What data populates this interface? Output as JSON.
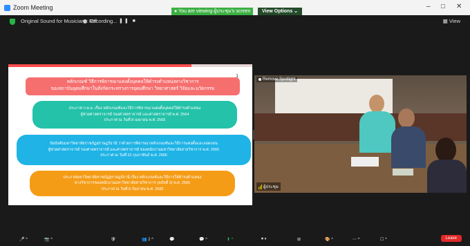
{
  "window": {
    "title": "Zoom Meeting",
    "minimize": "–",
    "maximize": "□",
    "close": "✕"
  },
  "share_banner": "● You are viewing ผู้ประชุม's screen",
  "view_options": "View Options ⌄",
  "topbar": {
    "audio_label": "Original Sound for Musicians: Off",
    "recording_label": "Recording...",
    "view_label": "View"
  },
  "slide": {
    "page_number": "1",
    "progress_fraction": 0.75,
    "title_lines": [
      "หลักเกณฑ์ วิธีการพิจารณาแต่งตั้งบุคคลให้ดำรงตำแหน่งทางวิชาการ",
      "ของสถาบันอุดมศึกษาในสังกัดกระทรวงการอุดมศึกษา วิทยาศาสตร์ วิจัยและนวัตกรรม"
    ],
    "box1": [
      "ประกาศ ก.พ.อ. เรื่อง หลักเกณฑ์และวิธีการพิจารณาแต่งตั้งบุคคลให้ดำรงตำแหน่ง",
      "ผู้ช่วยศาสตราจารย์ รองศาสตราจารย์ และศาสตราจารย์ พ.ศ. 2564",
      "ประกาศ ณ วันที่ 8 เมษายน พ.ศ. 2565"
    ],
    "box2": [
      "ข้อบังคับมหาวิทยาลัยราชภัฏสุราษฎร์ธานี ว่าด้วยการพิจารณาหลักเกณฑ์และวิธีการแต่งตั้งและถอดถอน",
      "ผู้ช่วยศาสตราจารย์ รองศาสตราจารย์ และศาสตราจารย์ ของพนักงานมหาวิทยาลัยสายวิชาการ พ.ศ. 2565",
      "ประกาศ ณ วันที่ 22 กุมภาพันธ์ พ.ศ. 2565"
    ],
    "box3": [
      "ประกาศมหาวิทยาลัยราชภัฏสุราษฎร์ธานี เรื่อง หลักเกณฑ์และวิธีการให้ดำรงตำแหน่ง",
      "ทางวิชาการของพนักงานมหาวิทยาลัยสายวิชาการ (ฉบับที่ 3) พ.ศ. 2565",
      "ประกาศ ณ วันที่ 8 กันยายน พ.ศ. 2565"
    ]
  },
  "video": {
    "spotlight_label": "Remove Spotlight",
    "participant_label": "ผู้ประชุม"
  },
  "toolbar": {
    "items": [
      "🎤 ^",
      "📷 ^",
      "🛡",
      "👥 2 ^",
      "💬",
      "💬 ^",
      "⬆ ^",
      "⏺ ⏸",
      "⊞",
      "🎨 ^",
      "⋯ ^",
      "☐ ^"
    ],
    "leave": "Leave"
  },
  "colors": {
    "title": "#f66f6f",
    "teal": "#23c2a9",
    "blue": "#1fb3e6",
    "orange": "#f59c16",
    "banner": "#3cb043"
  }
}
